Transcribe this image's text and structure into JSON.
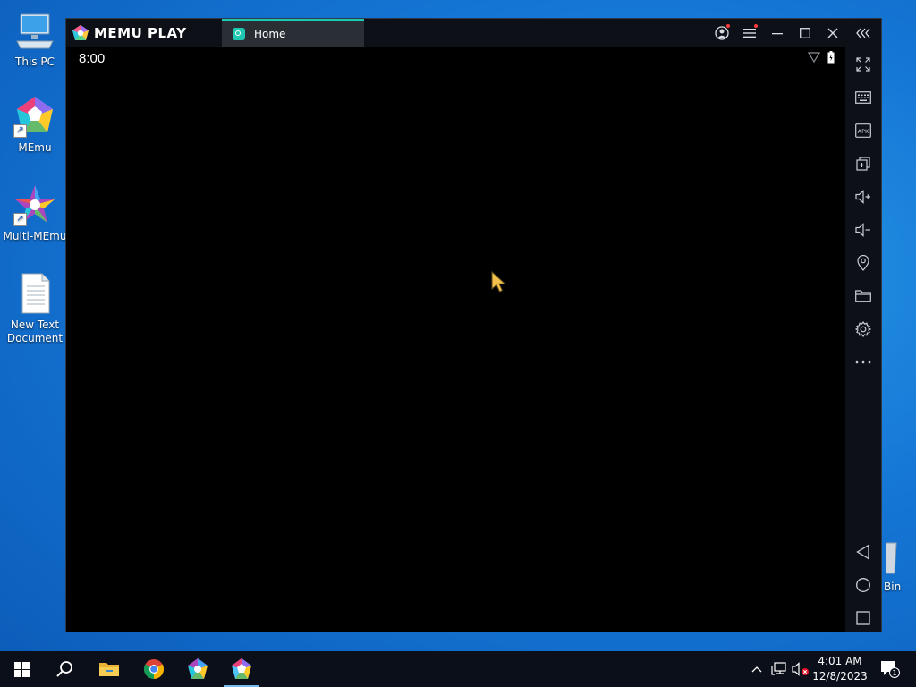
{
  "desktop": {
    "icons": [
      {
        "label": "This PC"
      },
      {
        "label": "MEmu"
      },
      {
        "label": "Multi-MEmu"
      },
      {
        "label": "New Text\nDocument"
      },
      {
        "label": "Bin"
      }
    ]
  },
  "window": {
    "brand": "MEMU PLAY",
    "tab_label": "Home",
    "android_clock": "8:00",
    "accent_color": "#1fc8b0"
  },
  "titlebar_buttons": [
    "account-icon",
    "menu-icon",
    "minimize-icon",
    "maximize-icon",
    "close-icon",
    "collapse-sidebar-icon"
  ],
  "sidebar_buttons": [
    "fullscreen-icon",
    "keyboard-mapping-icon",
    "apk-install-icon",
    "multi-instance-icon",
    "volume-up-icon",
    "volume-down-icon",
    "location-icon",
    "shared-folder-icon",
    "settings-icon",
    "more-icon",
    "android-back-icon",
    "android-home-icon",
    "android-recents-icon"
  ],
  "taskbar": {
    "time": "4:01 AM",
    "date": "12/8/2023",
    "notification_count": "1"
  }
}
